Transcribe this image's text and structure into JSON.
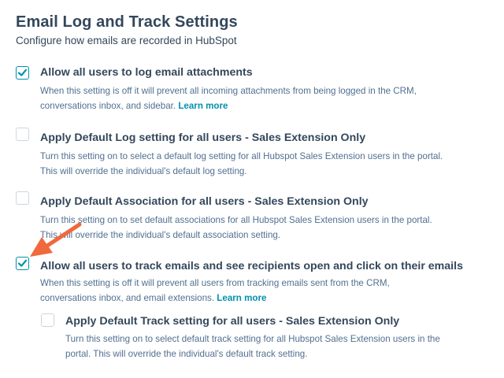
{
  "header": {
    "title": "Email Log and Track Settings",
    "subtitle": "Configure how emails are recorded in HubSpot"
  },
  "settings": [
    {
      "label": "Allow all users to log email attachments",
      "checked": true,
      "desc_line1": "When this setting is off it will prevent all incoming attachments from being logged in the CRM,",
      "desc_line2": "conversations inbox, and sidebar.",
      "link": "Learn more"
    },
    {
      "label": "Apply Default Log setting for all users - Sales Extension Only",
      "checked": false,
      "desc_line1": "Turn this setting on to select a default log setting for all Hubspot Sales Extension users in the portal.",
      "desc_line2": "This will override the individual's default log setting."
    },
    {
      "label": "Apply Default Association for all users - Sales Extension Only",
      "checked": false,
      "desc_line1": "Turn this setting on to set default associations for all Hubspot Sales Extension users in the portal.",
      "desc_line2": "This will override the individual's default association setting."
    },
    {
      "label": "Allow all users to track emails and see recipients open and click on their emails",
      "checked": true,
      "desc_line1": "When this setting is off it will prevent all users from tracking emails sent from the CRM,",
      "desc_line2": "conversations inbox, and email extensions.",
      "link": "Learn more"
    },
    {
      "label": "Apply Default Track setting for all users - Sales Extension Only",
      "checked": false,
      "desc_line1": "Turn this setting on to select default track setting for all Hubspot Sales Extension users in the",
      "desc_line2": "portal. This will override the individual's default track setting."
    }
  ],
  "colors": {
    "accent": "#0091ae",
    "heading": "#33475b",
    "description": "#516f90",
    "annotation_arrow": "#f0683c"
  }
}
